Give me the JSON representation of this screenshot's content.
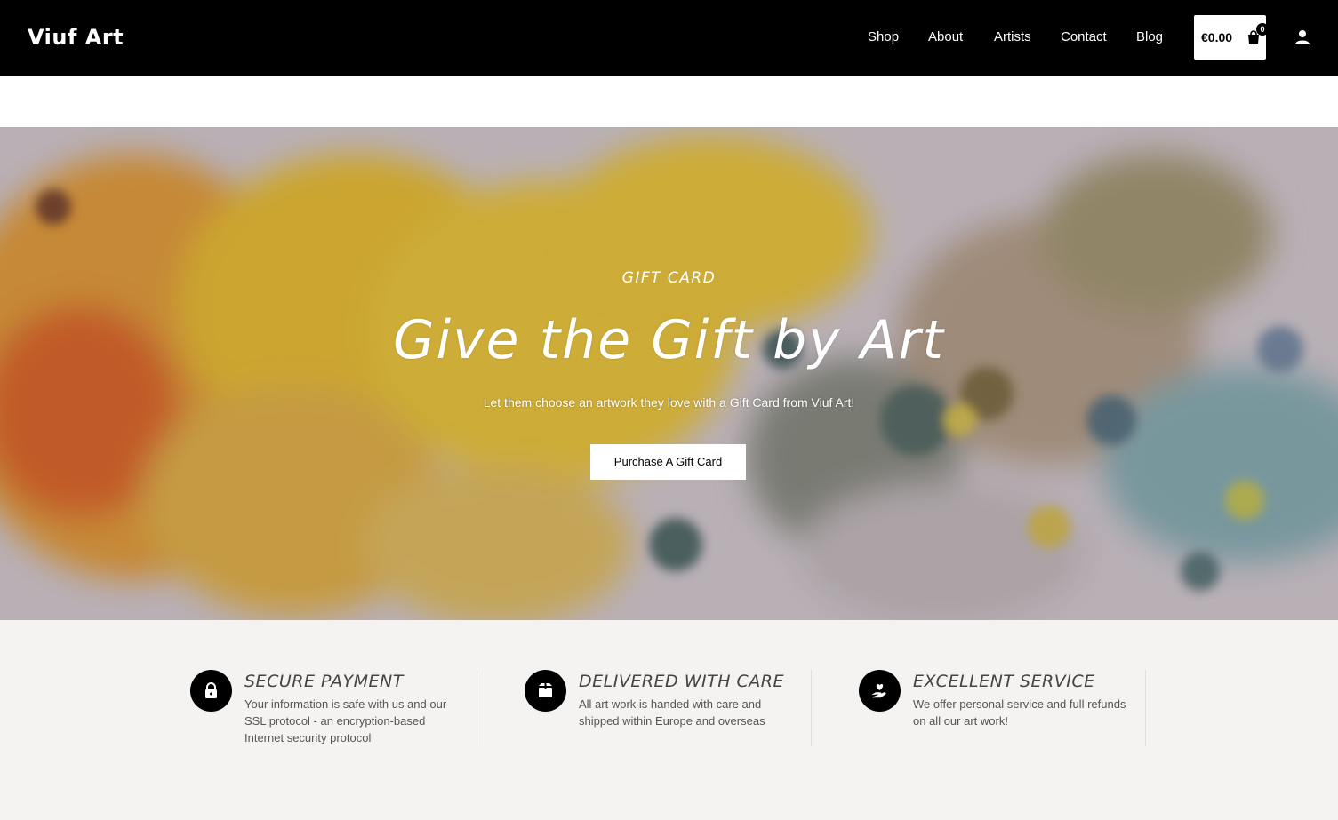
{
  "header": {
    "logo": "Viuf Art",
    "nav": [
      {
        "label": "Shop"
      },
      {
        "label": "About"
      },
      {
        "label": "Artists"
      },
      {
        "label": "Contact"
      },
      {
        "label": "Blog"
      }
    ],
    "cart": {
      "total": "€0.00",
      "count": "0",
      "icon": "shopping-bag-icon"
    },
    "account_icon": "user-icon"
  },
  "hero": {
    "eyebrow": "GIFT CARD",
    "title": "Give the Gift by Art",
    "subtitle": "Let them choose an artwork they love with a Gift Card from Viuf Art!",
    "button": "Purchase A Gift Card"
  },
  "features": [
    {
      "icon": "lock-icon",
      "title": "SECURE PAYMENT",
      "text": "Your information is safe with us and our SSL protocol - an encryption-based Internet security protocol"
    },
    {
      "icon": "box-icon",
      "title": "DELIVERED WITH CARE",
      "text": "All art work is handed with care and shipped within Europe and overseas"
    },
    {
      "icon": "hand-heart-icon",
      "title": "EXCELLENT SERVICE",
      "text": "We offer personal service and full refunds on all our art work!"
    }
  ],
  "colors": {
    "header_bg": "#000000",
    "page_bg": "#f5f2f2",
    "accent": "#ffffff"
  }
}
